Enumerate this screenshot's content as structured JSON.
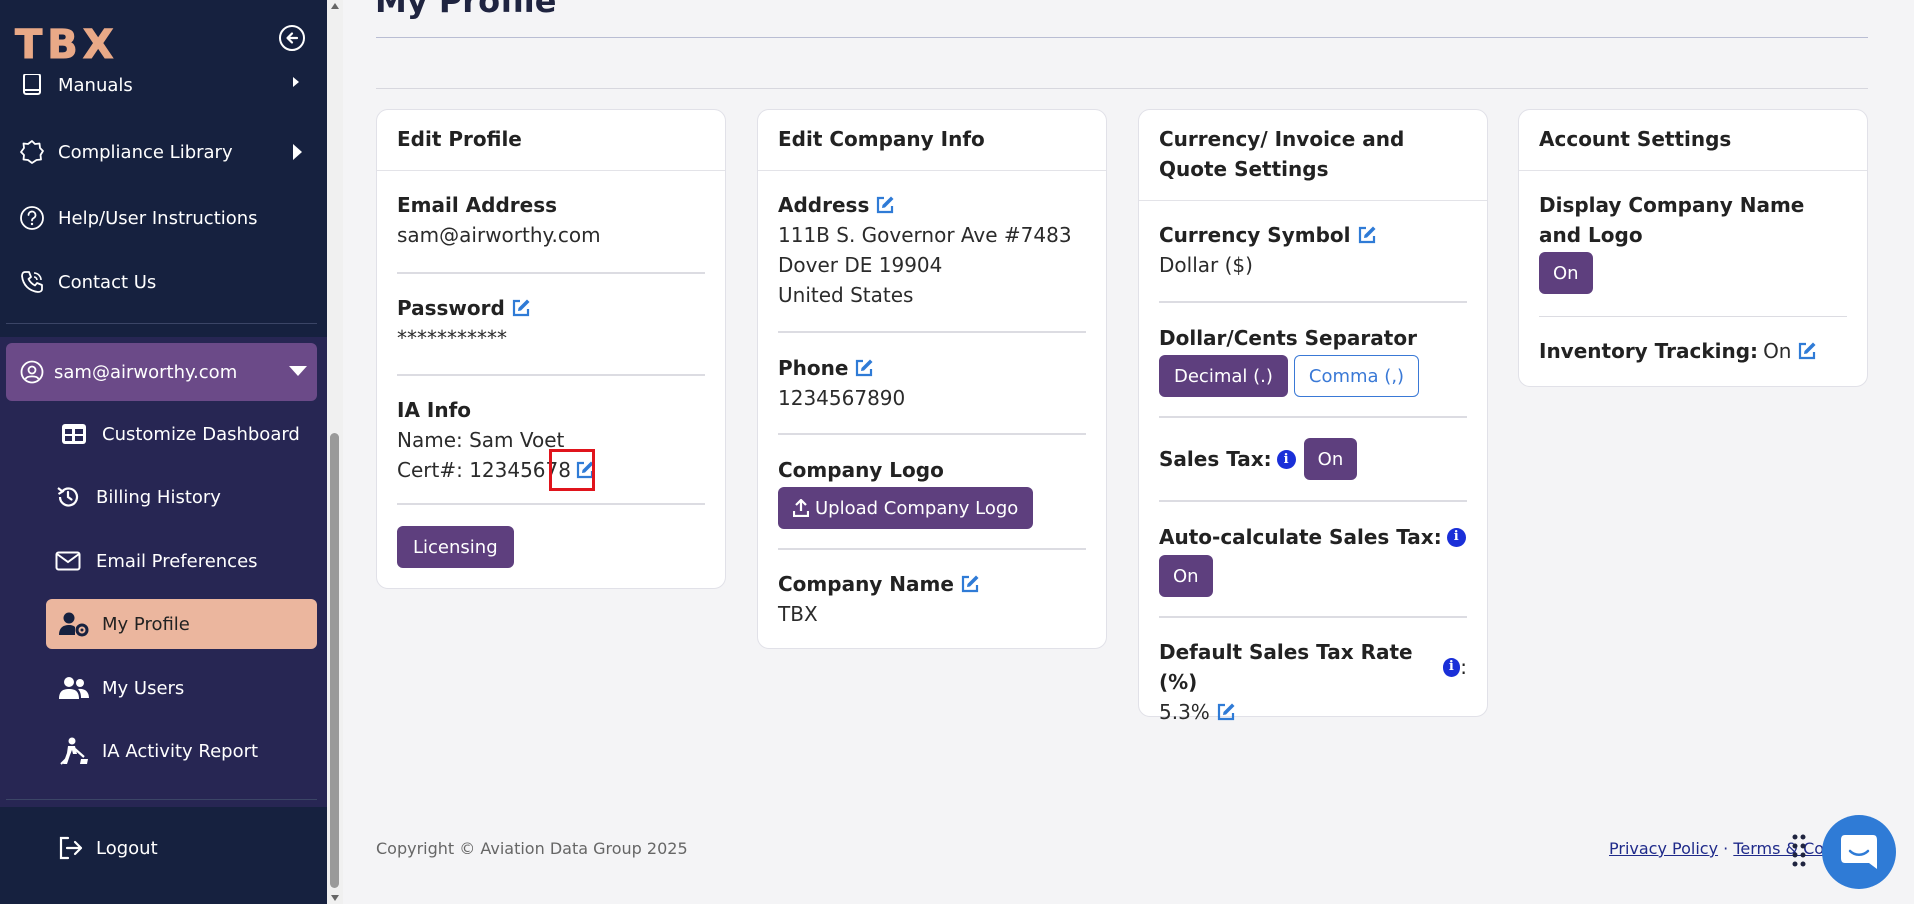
{
  "sidebar": {
    "logo": "TBX",
    "items": [
      {
        "label": "Manuals"
      },
      {
        "label": "Compliance Library"
      },
      {
        "label": "Help/User Instructions"
      },
      {
        "label": "Contact Us"
      }
    ],
    "user_email": "sam@airworthy.com",
    "sub_items": [
      {
        "label": "Customize Dashboard"
      },
      {
        "label": "Billing History"
      },
      {
        "label": "Email Preferences"
      },
      {
        "label": "My Profile"
      },
      {
        "label": "My Users"
      },
      {
        "label": "IA Activity Report"
      }
    ],
    "logout": "Logout"
  },
  "page": {
    "title": "My Profile"
  },
  "edit_profile": {
    "title": "Edit Profile",
    "email_label": "Email Address",
    "email_value": "sam@airworthy.com",
    "password_label": "Password",
    "password_value": "***********",
    "ia_label": "IA Info",
    "ia_name": "Name: Sam Voet",
    "ia_cert": "Cert#: 12345678",
    "licensing_button": "Licensing"
  },
  "company": {
    "title": "Edit Company Info",
    "address_label": "Address",
    "address_line1": "111B S. Governor Ave #7483",
    "address_line2": "Dover DE 19904",
    "address_line3": "United States",
    "phone_label": "Phone",
    "phone_value": "1234567890",
    "logo_label": "Company Logo",
    "upload_button": "Upload Company Logo",
    "name_label": "Company Name",
    "name_value": "TBX"
  },
  "currency": {
    "title": "Currency/ Invoice and Quote Settings",
    "symbol_label": "Currency Symbol",
    "symbol_value": "Dollar ($)",
    "separator_label": "Dollar/Cents Separator",
    "decimal_button": "Decimal (.)",
    "comma_button": "Comma (,)",
    "sales_tax_label": "Sales Tax:",
    "sales_tax_toggle": "On",
    "auto_calc_label": "Auto-calculate Sales Tax:",
    "auto_calc_toggle": "On",
    "default_rate_label": "Default Sales Tax Rate (%)",
    "default_rate_colon": ":",
    "default_rate_value": "5.3%"
  },
  "account": {
    "title": "Account Settings",
    "display_label": "Display Company Name and Logo",
    "display_toggle": "On",
    "inventory_label": "Inventory Tracking:",
    "inventory_value": "On"
  },
  "footer": {
    "copyright": "Copyright © Aviation Data Group 2025",
    "privacy": "Privacy Policy",
    "separator": "·",
    "terms": "Terms & Cond"
  },
  "colors": {
    "sidebar_bg": "#16213f",
    "accent_purple": "#5e3f7e",
    "active_item": "#ebb69e",
    "edit_blue": "#2f7bd6",
    "info_blue": "#1a2fd8",
    "highlight_red": "#e0141c"
  }
}
